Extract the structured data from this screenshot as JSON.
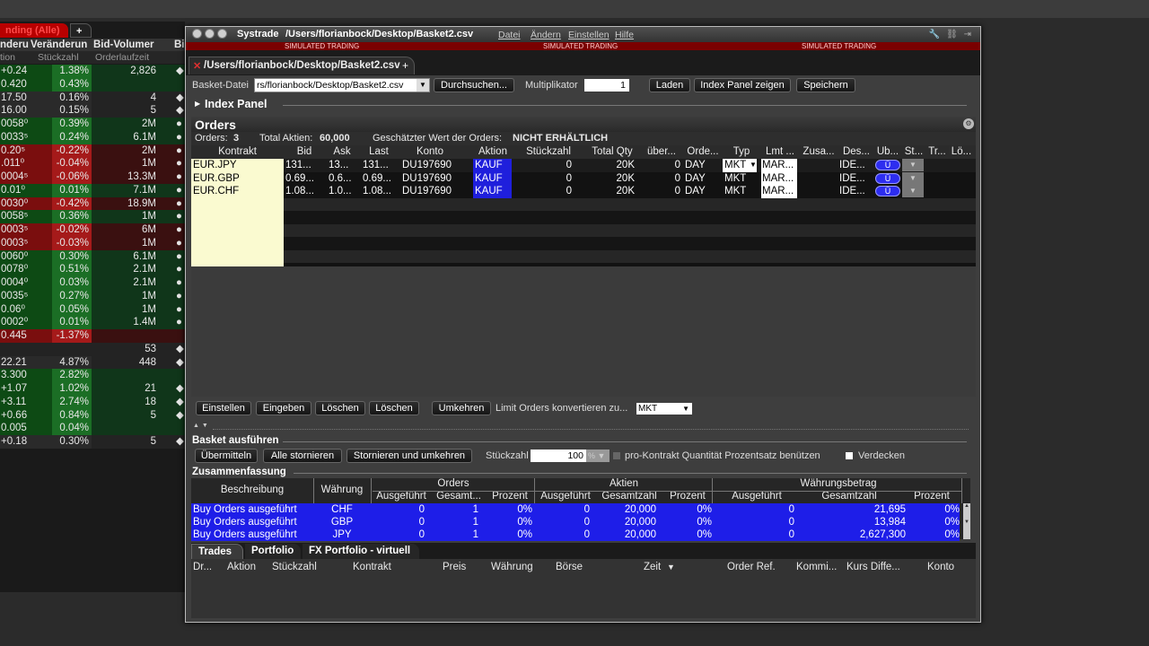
{
  "watchlist": {
    "tab_label": "nding (Alle)",
    "add_tab": "+",
    "headers": [
      "nderu",
      "Veränderun",
      "Bid-Volumer",
      "Bi"
    ],
    "subheaders": [
      "tion",
      "Stückzahl",
      "Orderlaufzeit"
    ],
    "rows": [
      {
        "a": "+0.24",
        "b": "1.38%",
        "c": "2,826",
        "d": "◆",
        "cls": "g"
      },
      {
        "a": "0.420",
        "b": "0.43%",
        "c": "",
        "d": "",
        "cls": "g"
      },
      {
        "a": "17.50",
        "b": "0.16%",
        "c": "4",
        "d": "◆ 10",
        "cls": "n"
      },
      {
        "a": "16.00",
        "b": "0.15%",
        "c": "5",
        "d": "◆ 10",
        "cls": "n"
      },
      {
        "a": "0058⁰",
        "b": "0.39%",
        "c": "2M",
        "d": "● 1.",
        "cls": "g"
      },
      {
        "a": "0033⁵",
        "b": "0.24%",
        "c": "6.1M",
        "d": "● 1.",
        "cls": "g"
      },
      {
        "a": "0.20⁵",
        "b": "-0.22%",
        "c": "2M",
        "d": "●",
        "cls": "r"
      },
      {
        "a": ".011⁰",
        "b": "-0.04%",
        "c": "1M",
        "d": "● 2",
        "cls": "r"
      },
      {
        "a": "0004⁵",
        "b": "-0.06%",
        "c": "13.3M",
        "d": "● 0.",
        "cls": "r"
      },
      {
        "a": "0.01⁰",
        "b": "0.01%",
        "c": "7.1M",
        "d": "● 1.",
        "cls": "g"
      },
      {
        "a": "0030⁰",
        "b": "-0.42%",
        "c": "18.9M",
        "d": "● 0.",
        "cls": "r"
      },
      {
        "a": "0058⁵",
        "b": "0.36%",
        "c": "1M",
        "d": "● 1.",
        "cls": "g"
      },
      {
        "a": "0003⁵",
        "b": "-0.02%",
        "c": "6M",
        "d": "● 1.",
        "cls": "r"
      },
      {
        "a": "0003⁵",
        "b": "-0.03%",
        "c": "1M",
        "d": "● 1.",
        "cls": "r"
      },
      {
        "a": "0060⁰",
        "b": "0.30%",
        "c": "6.1M",
        "d": "● 2.",
        "cls": "g"
      },
      {
        "a": "0078⁰",
        "b": "0.51%",
        "c": "2.1M",
        "d": "● 1.",
        "cls": "g"
      },
      {
        "a": "0004⁰",
        "b": "0.03%",
        "c": "2.1M",
        "d": "● 1.",
        "cls": "g"
      },
      {
        "a": "0035⁵",
        "b": "0.27%",
        "c": "1M",
        "d": "● 1.",
        "cls": "g"
      },
      {
        "a": "0.06⁰",
        "b": "0.05%",
        "c": "1M",
        "d": "● 1.",
        "cls": "g"
      },
      {
        "a": "0002⁰",
        "b": "0.01%",
        "c": "1.4M",
        "d": "● 1.",
        "cls": "g"
      },
      {
        "a": "0.445",
        "b": "-1.37%",
        "c": "",
        "d": "",
        "cls": "r"
      },
      {
        "a": "",
        "b": "",
        "c": "53",
        "d": "◆",
        "cls": "n"
      },
      {
        "a": "22.21",
        "b": "4.87%",
        "c": "448",
        "d": "◆",
        "cls": "n"
      },
      {
        "a": "3.300",
        "b": "2.82%",
        "c": "",
        "d": "",
        "cls": "g"
      },
      {
        "a": "+1.07",
        "b": "1.02%",
        "c": "21",
        "d": "◆",
        "cls": "g"
      },
      {
        "a": "+3.11",
        "b": "2.74%",
        "c": "18",
        "d": "◆",
        "cls": "g"
      },
      {
        "a": "+0.66",
        "b": "0.84%",
        "c": "5",
        "d": "◆",
        "cls": "g"
      },
      {
        "a": "0.005",
        "b": "0.04%",
        "c": "",
        "d": "",
        "cls": "g"
      },
      {
        "a": "+0.18",
        "b": "0.30%",
        "c": "5",
        "d": "◆",
        "cls": "n"
      }
    ]
  },
  "window": {
    "app_name": "Systrade",
    "path": "/Users/florianbock/Desktop/Basket2.csv",
    "menu": [
      "Datei",
      "Ändern",
      "Einstellen",
      "Hilfe"
    ],
    "title_icons": "🔧 ⛓ ⇥",
    "simulated": "SIMULATED TRADING"
  },
  "doc_tab": {
    "close": "✕",
    "title": "/Users/florianbock/Desktop/Basket2.csv",
    "add": "+"
  },
  "file_row": {
    "label": "Basket-Datei",
    "file_value": "rs/florianbock/Desktop/Basket2.csv",
    "browse": "Durchsuchen...",
    "mult_label": "Multiplikator",
    "mult_value": "1",
    "load": "Laden",
    "index_show": "Index Panel zeigen",
    "save": "Speichern"
  },
  "index_panel": {
    "title": "Index Panel"
  },
  "orders": {
    "title": "Orders",
    "count_label": "Orders:",
    "count": "3",
    "shares_label": "Total Aktien:",
    "shares": "60,000",
    "value_label": "Geschätzter Wert der Orders:",
    "value": "NICHT ERHÄLTLICH",
    "columns": [
      "Kontrakt",
      "Bid",
      "Ask",
      "Last",
      "Konto",
      "Aktion",
      "Stückzahl",
      "Total Qty",
      "über...",
      "Orde...",
      "Typ",
      "Lmt ...",
      "Zusa...",
      "Des...",
      "Üb...",
      "St...",
      "Tr...",
      "Lö..."
    ],
    "rows": [
      {
        "kontrakt": "EUR.JPY",
        "bid": "131...",
        "ask": "13...",
        "last": "131...",
        "konto": "DU197690",
        "aktion": "KAUF",
        "stk": "0",
        "total": "20K",
        "ueber": "0",
        "orde": "DAY",
        "typ": "MKT",
        "lmt": "MAR...",
        "des": "IDE...",
        "ub": "Ü"
      },
      {
        "kontrakt": "EUR.GBP",
        "bid": "0.69...",
        "ask": "0.6...",
        "last": "0.69...",
        "konto": "DU197690",
        "aktion": "KAUF",
        "stk": "0",
        "total": "20K",
        "ueber": "0",
        "orde": "DAY",
        "typ": "MKT",
        "lmt": "MAR...",
        "des": "IDE...",
        "ub": "Ü"
      },
      {
        "kontrakt": "EUR.CHF",
        "bid": "1.08...",
        "ask": "1.0...",
        "last": "1.08...",
        "konto": "DU197690",
        "aktion": "KAUF",
        "stk": "0",
        "total": "20K",
        "ueber": "0",
        "orde": "DAY",
        "typ": "MKT",
        "lmt": "MAR...",
        "des": "IDE...",
        "ub": "Ü"
      }
    ]
  },
  "order_buttons": {
    "einstellen": "Einstellen",
    "eingeben": "Eingeben",
    "loeschen1": "Löschen",
    "loeschen2": "Löschen",
    "umkehren": "Umkehren",
    "limit_label": "Limit Orders konvertieren zu...",
    "limit_value": "MKT"
  },
  "basket_exec": {
    "title": "Basket ausführen",
    "send": "Übermitteln",
    "cancel_all": "Alle stornieren",
    "cancel_reverse": "Stornieren und umkehren",
    "qty_label": "Stückzahl",
    "qty_value": "100",
    "pct": "%",
    "pro_label": "pro-Kontrakt Quantität Prozentsatz benützen",
    "hide_label": "Verdecken"
  },
  "summary": {
    "title": "Zusammenfassung",
    "groups": [
      "Orders",
      "Aktien",
      "Währungsbetrag"
    ],
    "desc": "Beschreibung",
    "currency": "Währung",
    "sub": [
      "Ausgeführt",
      "Gesamt...",
      "Prozent",
      "Ausgeführt",
      "Gesamtzahl",
      "Prozent",
      "Ausgeführt",
      "Gesamtzahl",
      "Prozent"
    ],
    "rows": [
      {
        "d": "Buy Orders ausgeführt",
        "w": "CHF",
        "o1": "0",
        "o2": "1",
        "o3": "0%",
        "a1": "0",
        "a2": "20,000",
        "a3": "0%",
        "c1": "0",
        "c2": "21,695",
        "c3": "0%"
      },
      {
        "d": "Buy Orders ausgeführt",
        "w": "GBP",
        "o1": "0",
        "o2": "1",
        "o3": "0%",
        "a1": "0",
        "a2": "20,000",
        "a3": "0%",
        "c1": "0",
        "c2": "13,984",
        "c3": "0%"
      },
      {
        "d": "Buy Orders ausgeführt",
        "w": "JPY",
        "o1": "0",
        "o2": "1",
        "o3": "0%",
        "a1": "0",
        "a2": "20,000",
        "a3": "0%",
        "c1": "0",
        "c2": "2,627,300",
        "c3": "0%"
      }
    ]
  },
  "trades": {
    "tabs": [
      "Trades",
      "Portfolio",
      "FX Portfolio - virtuell"
    ],
    "columns": [
      "Dr...",
      "Aktion",
      "Stückzahl",
      "Kontrakt",
      "Preis",
      "Währung",
      "Börse",
      "Zeit",
      "Order Ref.",
      "Kommi...",
      "Kurs Diffe...",
      "Konto"
    ]
  }
}
